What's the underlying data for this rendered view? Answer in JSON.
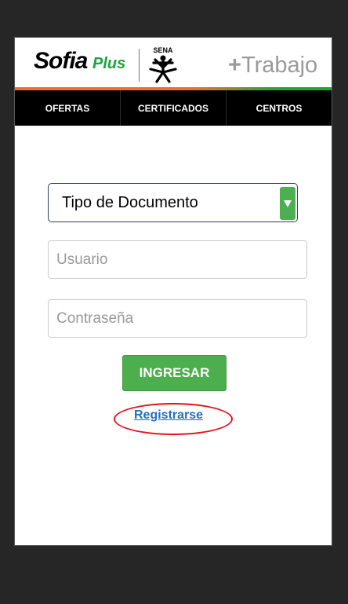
{
  "header": {
    "logo_sofia": "Sofia",
    "logo_plus": "Plus",
    "sena_label": "SENA",
    "trabajo_plus": "+",
    "trabajo_text": "Trabajo"
  },
  "nav": {
    "items": [
      "OFERTAS",
      "CERTIFICADOS",
      "CENTROS"
    ]
  },
  "form": {
    "document_type_label": "Tipo de Documento",
    "user_placeholder": "Usuario",
    "password_placeholder": "Contraseña",
    "submit_label": "INGRESAR",
    "register_link": "Registrarse"
  },
  "colors": {
    "accent_green": "#4cae4c",
    "accent_orange": "#f36f21",
    "nav_bg": "#000000",
    "annotation_red": "#e8101a",
    "link_blue": "#1f6fc2"
  }
}
